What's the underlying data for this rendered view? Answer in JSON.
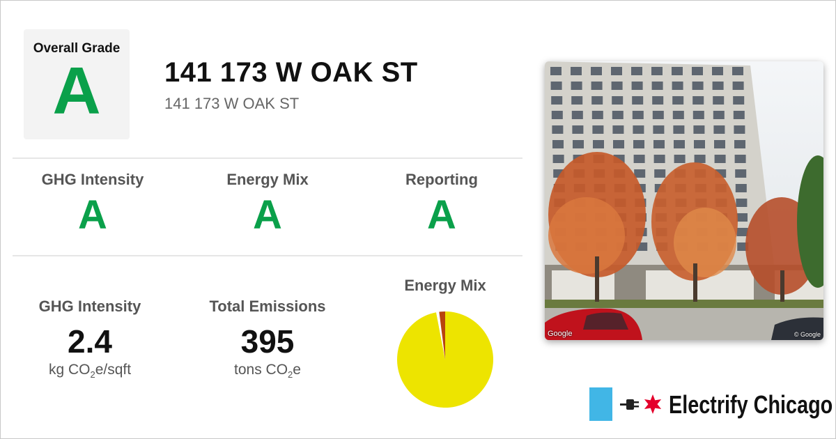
{
  "overall": {
    "label": "Overall Grade",
    "grade": "A"
  },
  "building": {
    "title": "141 173 W OAK ST",
    "subtitle": "141 173 W OAK ST"
  },
  "sub_grades": [
    {
      "label": "GHG Intensity",
      "grade": "A"
    },
    {
      "label": "Energy Mix",
      "grade": "A"
    },
    {
      "label": "Reporting",
      "grade": "A"
    }
  ],
  "stats": [
    {
      "label": "GHG Intensity",
      "value": "2.4",
      "unit_pre": "kg CO",
      "unit_sub": "2",
      "unit_post": "e/sqft"
    },
    {
      "label": "Total Emissions",
      "value": "395",
      "unit_pre": "tons CO",
      "unit_sub": "2",
      "unit_post": "e"
    }
  ],
  "energy_mix": {
    "label": "Energy Mix",
    "chart_data": {
      "type": "pie",
      "slices": [
        {
          "value": 97,
          "color": "#ede400"
        },
        {
          "value": 1,
          "color": "#ffffff"
        },
        {
          "value": 2,
          "color": "#b8430e"
        }
      ]
    }
  },
  "photo": {
    "watermark": "Google",
    "watermark_right": "© Google"
  },
  "brand": {
    "name": "Electrify Chicago"
  },
  "colors": {
    "grade_green": "#0aa04a",
    "flag_blue": "#41b6e6",
    "star_red": "#e4002b"
  }
}
